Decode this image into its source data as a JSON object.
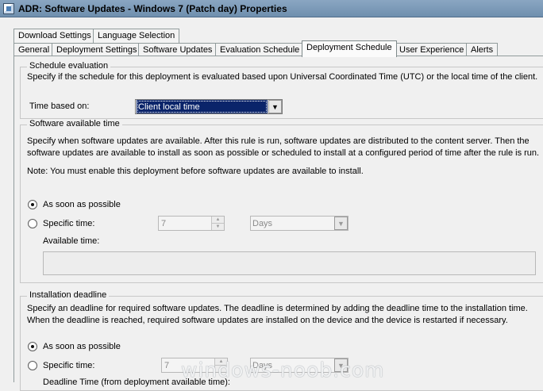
{
  "window": {
    "title": "ADR:  Software Updates - Windows 7 (Patch day) Properties"
  },
  "tabs_row1": [
    "Download Settings",
    "Language Selection"
  ],
  "tabs_row2": [
    "General",
    "Deployment Settings",
    "Software Updates",
    "Evaluation Schedule",
    "Deployment Schedule",
    "User Experience",
    "Alerts"
  ],
  "active_tab": "Deployment Schedule",
  "schedule_evaluation": {
    "legend": "Schedule evaluation",
    "description": "Specify if the schedule for this deployment is evaluated based upon Universal Coordinated Time (UTC) or the local time of the client.",
    "time_based_label": "Time based on:",
    "time_based_value": "Client local time"
  },
  "software_available": {
    "legend": "Software available time",
    "description": "Specify when software updates are available. After this rule is run, software updates are distributed to the content server. Then the software updates are available to install as soon as possible or scheduled to install at a configured period of time after the rule is run.",
    "note": "Note: You must enable this deployment before software updates are available to install.",
    "asap_label": "As soon as possible",
    "specific_label": "Specific time:",
    "specific_value": "7",
    "unit_value": "Days",
    "available_time_label": "Available time:",
    "asap_selected": true
  },
  "installation_deadline": {
    "legend": "Installation deadline",
    "description": "Specify an deadline for required software updates. The deadline is determined by adding the deadline time to the installation time. When the deadline is reached, required software updates are installed on the device and the device is restarted if necessary.",
    "asap_label": "As soon as possible",
    "specific_label": "Specific time:",
    "specific_value": "7",
    "unit_value": "Days",
    "deadline_time_label": "Deadline Time (from deployment available time):",
    "asap_selected": true
  },
  "watermark": "windows-noob.com"
}
